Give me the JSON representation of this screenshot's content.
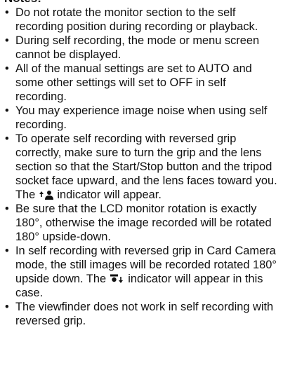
{
  "notes": {
    "title": "Notes:",
    "bullet": "•",
    "items": [
      {
        "text": "Do not rotate the monitor section to the self recording position during recording or playback."
      },
      {
        "text": "During self recording, the mode or menu screen cannot be displayed."
      },
      {
        "text": "All of the manual settings are set to AUTO and some other settings will set to OFF in self recording."
      },
      {
        "text": "You may experience image noise when using self recording."
      },
      {
        "text_before": "To operate self recording with reversed grip correctly, make sure to turn the grip and the lens section so that the Start/Stop button and the tripod socket face upward, and the lens faces toward you. The",
        "icon": "self-recording-reversed-grip-icon",
        "text_after": "indicator will appear."
      },
      {
        "text": "Be sure that the LCD monitor rotation is exactly 180°, otherwise the image recorded will be rotated 180° upside-down."
      },
      {
        "text_before": "In self recording with reversed grip in Card Camera mode, the still images will be recorded rotated 180° upside down. The",
        "icon": "upside-down-recording-icon",
        "text_after": "indicator will appear in this case."
      },
      {
        "text": "The viewfinder does not work in self recording with reversed grip."
      }
    ]
  }
}
